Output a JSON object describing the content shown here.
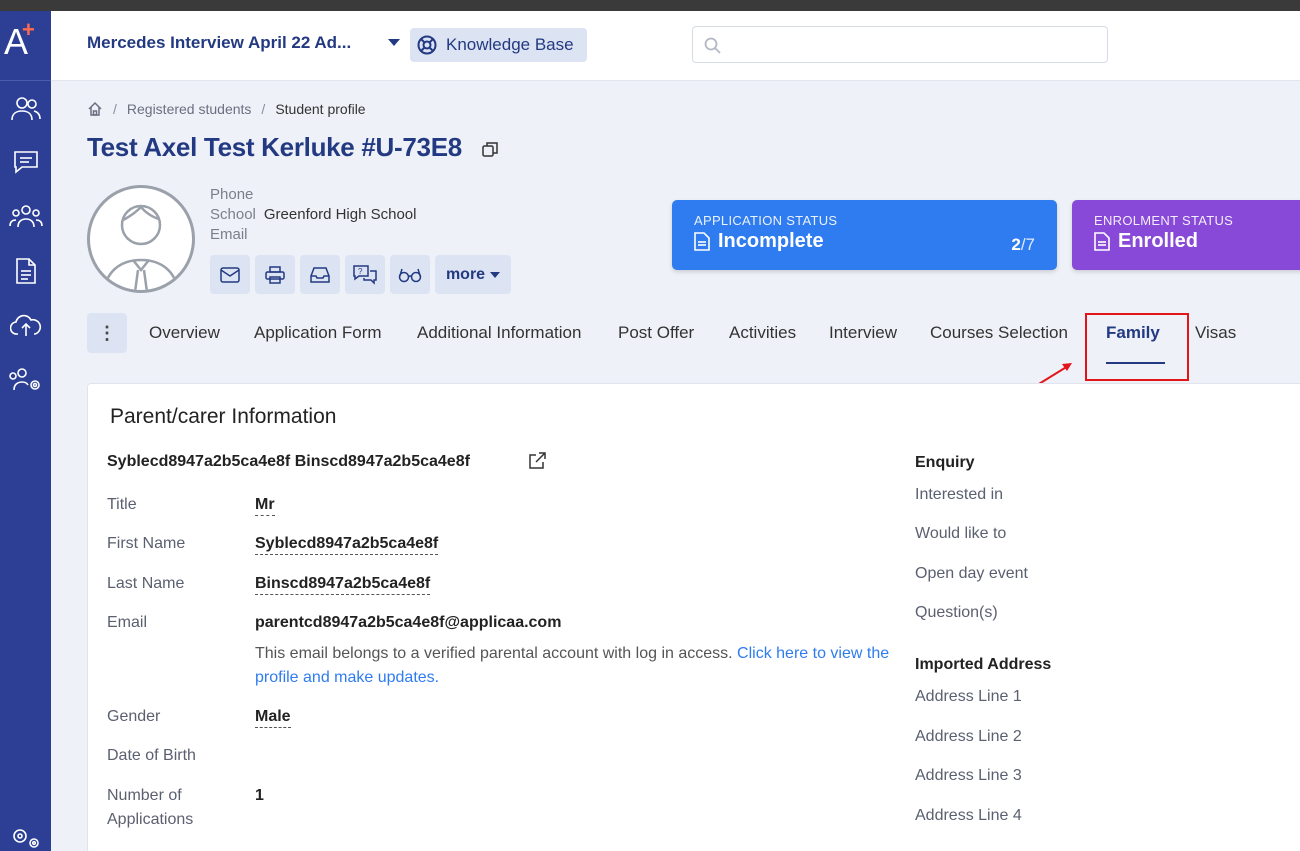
{
  "app": {
    "logo_letter": "A",
    "logo_mark": "+",
    "project_title": "Mercedes Interview April 22 Ad...",
    "knowledge_base_label": "Knowledge Base",
    "search_placeholder": ""
  },
  "breadcrumb": {
    "items": [
      "Registered students",
      "Student profile"
    ],
    "separator": "/"
  },
  "student": {
    "title": "Test Axel Test Kerluke #U-73E8",
    "phone_label": "Phone",
    "phone_value": "",
    "school_label": "School",
    "school_value": "Greenford High School",
    "email_label": "Email",
    "email_value": "",
    "more_label": "more"
  },
  "status": {
    "application_label": "APPLICATION STATUS",
    "application_value": "Incomplete",
    "application_step": "2",
    "application_total": "/7",
    "enrolment_label": "ENROLMENT STATUS",
    "enrolment_value": "Enrolled"
  },
  "tabs": {
    "kebab": "⋮",
    "items": [
      "Overview",
      "Application Form",
      "Additional Information",
      "Post Offer",
      "Activities",
      "Interview",
      "Courses Selection",
      "Family",
      "Visas"
    ],
    "active": "Family"
  },
  "parent": {
    "section_title": "Parent/carer Information",
    "full_name": "Syblecd8947a2b5ca4e8f Binscd8947a2b5ca4e8f",
    "fields": {
      "title_label": "Title",
      "title_value": "Mr",
      "first_name_label": "First Name",
      "first_name_value": "Syblecd8947a2b5ca4e8f",
      "last_name_label": "Last Name",
      "last_name_value": "Binscd8947a2b5ca4e8f",
      "email_label": "Email",
      "email_value": "parentcd8947a2b5ca4e8f@applicaa.com",
      "email_note": "This email belongs to a verified parental account with log in access.",
      "email_link_1": "Click here",
      "email_link_2": "to view the profile and make updates.",
      "gender_label": "Gender",
      "gender_value": "Male",
      "dob_label": "Date of Birth",
      "apps_label_1": "Number of",
      "apps_label_2": "Applications",
      "apps_value": "1"
    }
  },
  "enquiry": {
    "heading": "Enquiry",
    "items": [
      "Interested in",
      "Would like to",
      "Open day event",
      "Question(s)"
    ]
  },
  "imported_address": {
    "heading": "Imported Address",
    "items": [
      "Address Line 1",
      "Address Line 2",
      "Address Line 3",
      "Address Line 4"
    ]
  },
  "colors": {
    "sidebar": "#2c3f95",
    "brand_text": "#233a82",
    "application_status": "#2f7cf0",
    "enrolment_status": "#8848d8",
    "highlight": "#e4141b"
  }
}
